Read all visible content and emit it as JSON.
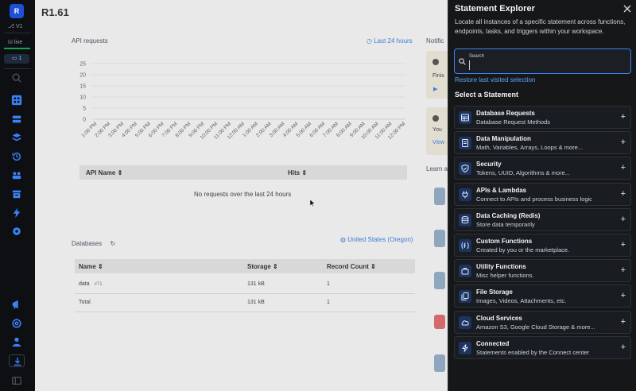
{
  "rail": {
    "logo_letter": "R",
    "version": "V1",
    "environment": "live",
    "badge_count": "1"
  },
  "main": {
    "title": "R1.61",
    "api_requests": {
      "heading": "API requests",
      "range_link": "Last 24 hours",
      "table_headers": [
        "API Name",
        "Hits"
      ],
      "empty_message": "No requests over the last 24 hours"
    },
    "notifications_label": "Notific",
    "learn_label": "Learn a",
    "card1": {
      "line1": "Finis",
      "line2": ""
    },
    "card2": {
      "line1": "You",
      "line2": "View"
    },
    "databases": {
      "heading": "Databases",
      "region_link": "United States (Oregon)",
      "headers": [
        "Name",
        "Storage",
        "Record Count"
      ],
      "rows": [
        {
          "name": "data",
          "id": "#71",
          "storage": "131 kB",
          "count": "1"
        },
        {
          "name": "Total",
          "id": "",
          "storage": "131 kB",
          "count": "1"
        }
      ]
    }
  },
  "chart_data": {
    "type": "line",
    "title": "",
    "y_ticks": [
      "25",
      "20",
      "15",
      "10",
      "5",
      "0"
    ],
    "ylim": [
      0,
      25
    ],
    "x": [
      "1:00 PM",
      "2:00 PM",
      "3:00 PM",
      "4:00 PM",
      "5:00 PM",
      "6:00 PM",
      "7:00 PM",
      "8:00 PM",
      "9:00 PM",
      "10:00 PM",
      "11:00 PM",
      "12:00 AM",
      "1:00 AM",
      "2:00 AM",
      "3:00 AM",
      "4:00 AM",
      "5:00 AM",
      "6:00 AM",
      "7:00 AM",
      "8:00 AM",
      "9:00 AM",
      "10:00 AM",
      "11:00 AM",
      "12:00 PM"
    ],
    "series": [
      {
        "values": [
          0,
          0,
          0,
          0,
          0,
          0,
          0,
          0,
          0,
          0,
          0,
          0,
          0,
          0,
          0,
          0,
          0,
          0,
          0,
          0,
          0,
          0,
          0,
          0
        ]
      }
    ],
    "grid": true
  },
  "panel": {
    "title": "Statement Explorer",
    "description": "Locate all instances of a specific statement across functions, endpoints, tasks, and triggers within your workspace.",
    "search_label": "Search",
    "search_value": "",
    "restore_link": "Restore last visited selection",
    "subheading": "Select a Statement",
    "items": [
      {
        "name": "Database Requests",
        "desc": "Database Request Methods",
        "icon": "database-table-icon"
      },
      {
        "name": "Data Manipulation",
        "desc": "Math, Variables, Arrays, Loops & more...",
        "icon": "document-icon"
      },
      {
        "name": "Security",
        "desc": "Tokens, UUID, Algorithms & more...",
        "icon": "shield-icon"
      },
      {
        "name": "APIs & Lambdas",
        "desc": "Connect to APIs and process business logic",
        "icon": "plug-icon"
      },
      {
        "name": "Data Caching (Redis)",
        "desc": "Store data temporarily",
        "icon": "database-icon"
      },
      {
        "name": "Custom Functions",
        "desc": "Created by you or the marketplace.",
        "icon": "function-icon"
      },
      {
        "name": "Utility Functions",
        "desc": "Misc helper functions.",
        "icon": "briefcase-icon"
      },
      {
        "name": "File Storage",
        "desc": "Images, Videos, Attachments, etc.",
        "icon": "files-icon"
      },
      {
        "name": "Cloud Services",
        "desc": "Amazon S3, Google Cloud Storage & more...",
        "icon": "cloud-icon"
      },
      {
        "name": "Connected",
        "desc": "Statements enabled by the Connect center",
        "icon": "bolt-icon"
      }
    ],
    "plus_glyph": "+"
  }
}
